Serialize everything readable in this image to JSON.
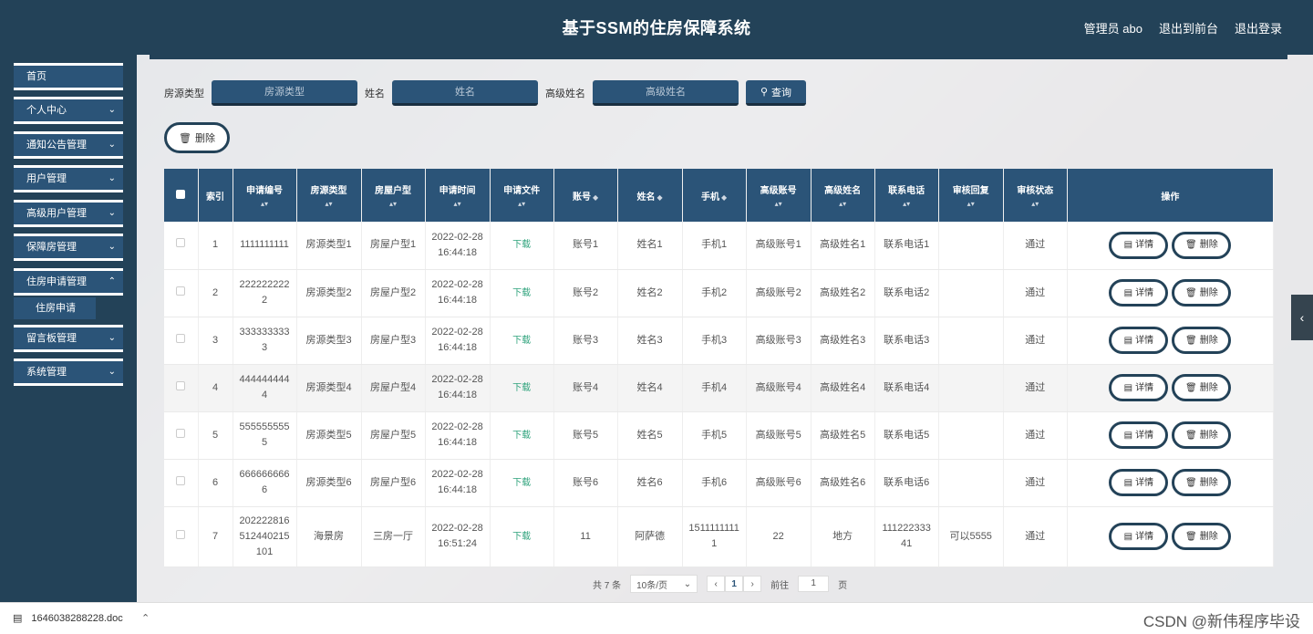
{
  "header": {
    "title": "基于SSM的住房保障系统",
    "admin": "管理员 abo",
    "back_front": "退出到前台",
    "logout": "退出登录"
  },
  "sidebar": {
    "items": [
      {
        "label": "首页"
      },
      {
        "label": "个人中心"
      },
      {
        "label": "通知公告管理"
      },
      {
        "label": "用户管理"
      },
      {
        "label": "高级用户管理"
      },
      {
        "label": "保障房管理"
      },
      {
        "label": "住房申请管理"
      },
      {
        "label": "留言板管理"
      },
      {
        "label": "系统管理"
      }
    ],
    "sub_item": "住房申请"
  },
  "search": {
    "label1": "房源类型",
    "placeholder1": "房源类型",
    "label2": "姓名",
    "placeholder2": "姓名",
    "label3": "高级姓名",
    "placeholder3": "高级姓名",
    "button": "查询"
  },
  "delete_button": "删除",
  "table": {
    "headers": [
      "索引",
      "申请编号",
      "房源类型",
      "房屋户型",
      "申请时间",
      "申请文件",
      "账号",
      "姓名",
      "手机",
      "高级账号",
      "高级姓名",
      "联系电话",
      "审核回复",
      "审核状态",
      "操作"
    ],
    "rows": [
      {
        "idx": "1",
        "no": "1111111111",
        "type": "房源类型1",
        "layout": "房屋户型1",
        "time": "2022-02-28 16:44:18",
        "file": "下载",
        "account": "账号1",
        "name": "姓名1",
        "phone": "手机1",
        "gacct": "高级账号1",
        "gname": "高级姓名1",
        "tel": "联系电话1",
        "reply": "",
        "status": "通过"
      },
      {
        "idx": "2",
        "no": "2222222222",
        "type": "房源类型2",
        "layout": "房屋户型2",
        "time": "2022-02-28 16:44:18",
        "file": "下载",
        "account": "账号2",
        "name": "姓名2",
        "phone": "手机2",
        "gacct": "高级账号2",
        "gname": "高级姓名2",
        "tel": "联系电话2",
        "reply": "",
        "status": "通过"
      },
      {
        "idx": "3",
        "no": "3333333333",
        "type": "房源类型3",
        "layout": "房屋户型3",
        "time": "2022-02-28 16:44:18",
        "file": "下载",
        "account": "账号3",
        "name": "姓名3",
        "phone": "手机3",
        "gacct": "高级账号3",
        "gname": "高级姓名3",
        "tel": "联系电话3",
        "reply": "",
        "status": "通过"
      },
      {
        "idx": "4",
        "no": "4444444444",
        "type": "房源类型4",
        "layout": "房屋户型4",
        "time": "2022-02-28 16:44:18",
        "file": "下载",
        "account": "账号4",
        "name": "姓名4",
        "phone": "手机4",
        "gacct": "高级账号4",
        "gname": "高级姓名4",
        "tel": "联系电话4",
        "reply": "",
        "status": "通过"
      },
      {
        "idx": "5",
        "no": "5555555555",
        "type": "房源类型5",
        "layout": "房屋户型5",
        "time": "2022-02-28 16:44:18",
        "file": "下载",
        "account": "账号5",
        "name": "姓名5",
        "phone": "手机5",
        "gacct": "高级账号5",
        "gname": "高级姓名5",
        "tel": "联系电话5",
        "reply": "",
        "status": "通过"
      },
      {
        "idx": "6",
        "no": "6666666666",
        "type": "房源类型6",
        "layout": "房屋户型6",
        "time": "2022-02-28 16:44:18",
        "file": "下载",
        "account": "账号6",
        "name": "姓名6",
        "phone": "手机6",
        "gacct": "高级账号6",
        "gname": "高级姓名6",
        "tel": "联系电话6",
        "reply": "",
        "status": "通过"
      },
      {
        "idx": "7",
        "no": "202222816512440215101",
        "type": "海景房",
        "layout": "三房一厅",
        "time": "2022-02-28 16:51:24",
        "file": "下载",
        "account": "11",
        "name": "阿萨德",
        "phone": "15111111111",
        "gacct": "22",
        "gname": "地方",
        "tel": "11122233341",
        "reply": "可以5555",
        "status": "通过"
      }
    ],
    "detail_label": "详情",
    "delete_label": "删除"
  },
  "pagination": {
    "total": "共 7 条",
    "page_size": "10条/页",
    "current": "1",
    "goto_label": "前往",
    "goto_value": "1",
    "page_unit": "页"
  },
  "download_bar": {
    "filename": "1646038288228.doc",
    "watermark": "CSDN @新伟程序毕设"
  },
  "colors": {
    "primary": "#2b5478",
    "dark": "#234258",
    "download_green": "#2fa37c"
  }
}
